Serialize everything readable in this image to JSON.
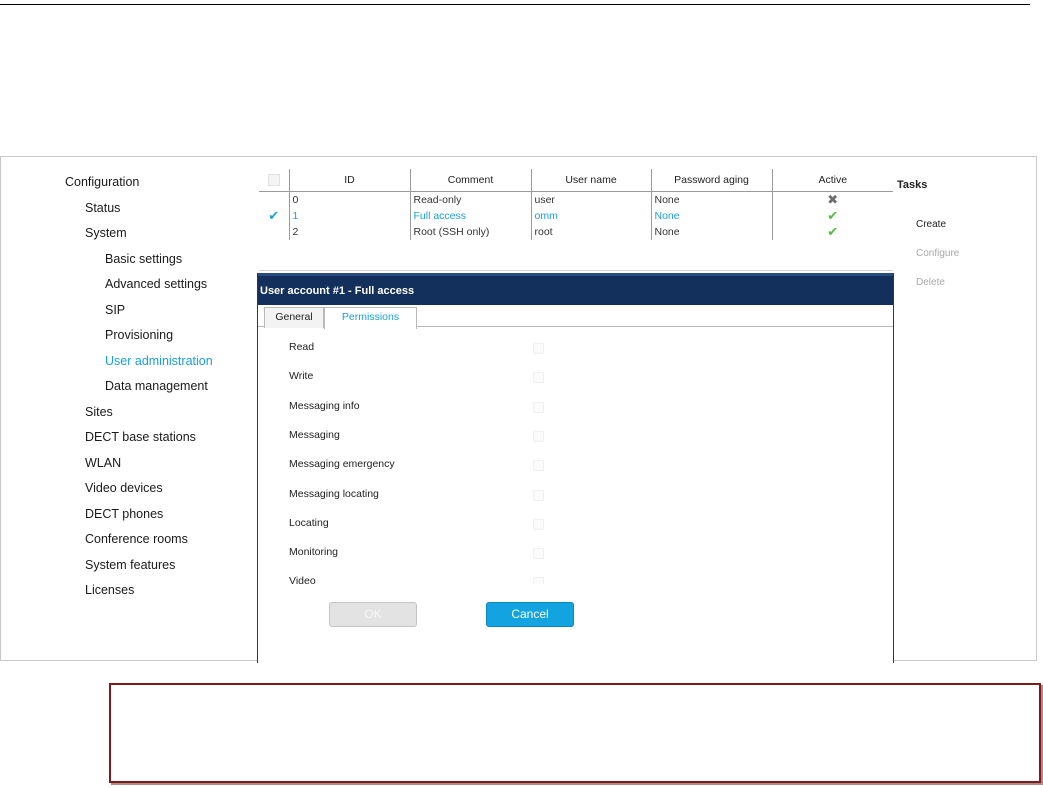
{
  "sidebar": {
    "items": [
      {
        "label": "Configuration",
        "level": 0,
        "active": false
      },
      {
        "label": "Status",
        "level": 1,
        "active": false
      },
      {
        "label": "System",
        "level": 1,
        "active": false
      },
      {
        "label": "Basic settings",
        "level": 2,
        "active": false
      },
      {
        "label": "Advanced settings",
        "level": 2,
        "active": false
      },
      {
        "label": "SIP",
        "level": 2,
        "active": false
      },
      {
        "label": "Provisioning",
        "level": 2,
        "active": false
      },
      {
        "label": "User administration",
        "level": 2,
        "active": true
      },
      {
        "label": "Data management",
        "level": 2,
        "active": false
      },
      {
        "label": "Sites",
        "level": 1,
        "active": false
      },
      {
        "label": "DECT base stations",
        "level": 1,
        "active": false
      },
      {
        "label": "WLAN",
        "level": 1,
        "active": false
      },
      {
        "label": "Video devices",
        "level": 1,
        "active": false
      },
      {
        "label": "DECT phones",
        "level": 1,
        "active": false
      },
      {
        "label": "Conference rooms",
        "level": 1,
        "active": false
      },
      {
        "label": "System features",
        "level": 1,
        "active": false
      },
      {
        "label": "Licenses",
        "level": 1,
        "active": false
      }
    ]
  },
  "table": {
    "columns": [
      "ID",
      "Comment",
      "User name",
      "Password aging",
      "Active"
    ],
    "rows": [
      {
        "id": "0",
        "comment": "Read-only",
        "username": "user",
        "aging": "None",
        "active": false,
        "selected": false
      },
      {
        "id": "1",
        "comment": "Full access",
        "username": "omm",
        "aging": "None",
        "active": true,
        "selected": true
      },
      {
        "id": "2",
        "comment": "Root (SSH only)",
        "username": "root",
        "aging": "None",
        "active": true,
        "selected": false
      }
    ],
    "icons": {
      "selected": "checkmark-icon",
      "active": "checkmark-icon",
      "inactive": "cross-icon"
    },
    "colors": {
      "selected": "#1a9fd9",
      "active": "#4fbf3a",
      "inactive": "#6d6d6d"
    }
  },
  "panel": {
    "title": "User account #1 - Full access",
    "tabs": [
      "General",
      "Permissions"
    ],
    "active_tab": "Permissions",
    "permissions": [
      "Read",
      "Write",
      "Messaging info",
      "Messaging",
      "Messaging emergency",
      "Messaging locating",
      "Locating",
      "Monitoring",
      "Video"
    ],
    "buttons": {
      "ok": "OK",
      "cancel": "Cancel"
    },
    "colors": {
      "header": "#13305c",
      "accent": "#1a9fd9",
      "cancel": "#12a3e0"
    }
  },
  "tasks": {
    "title": "Tasks",
    "items": [
      {
        "label": "Create",
        "enabled": true
      },
      {
        "label": "Configure",
        "enabled": false
      },
      {
        "label": "Delete",
        "enabled": false
      }
    ]
  }
}
